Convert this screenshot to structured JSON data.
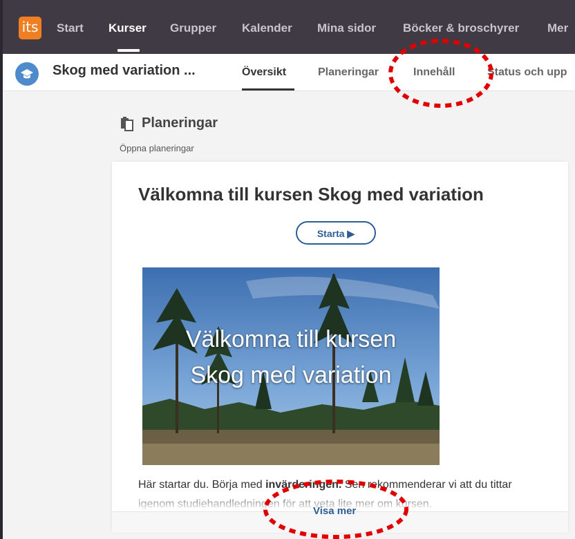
{
  "topnav": {
    "logo": "its",
    "items": [
      {
        "label": "Start"
      },
      {
        "label": "Kurser"
      },
      {
        "label": "Grupper"
      },
      {
        "label": "Kalender"
      },
      {
        "label": "Mina sidor"
      },
      {
        "label": "Böcker & broschyrer"
      },
      {
        "label": "Mer"
      }
    ]
  },
  "subnav": {
    "course_title": "Skog med variation ...",
    "tabs": [
      {
        "label": "Översikt"
      },
      {
        "label": "Planeringar"
      },
      {
        "label": "Innehåll"
      },
      {
        "label": "Status och upp"
      }
    ]
  },
  "section": {
    "title": "Planeringar",
    "subtitle": "Öppna planeringar"
  },
  "card": {
    "title": "Välkomna till kursen Skog med variation",
    "start_button": "Starta ▶",
    "hero_line1": "Välkomna till kursen",
    "hero_line2": "Skog med variation",
    "body_pre": "Här startar du. Börja med ",
    "body_bold": "invärderingen.",
    "body_post": " Sen rekommenderar vi att du tittar igenom studiehandledningen för att veta lite mer om kursen.",
    "more_link": "Visa mer"
  },
  "colors": {
    "nav_bg": "#403a45",
    "accent": "#ef7f22",
    "link": "#2c5d95",
    "annotation": "#e00000"
  }
}
